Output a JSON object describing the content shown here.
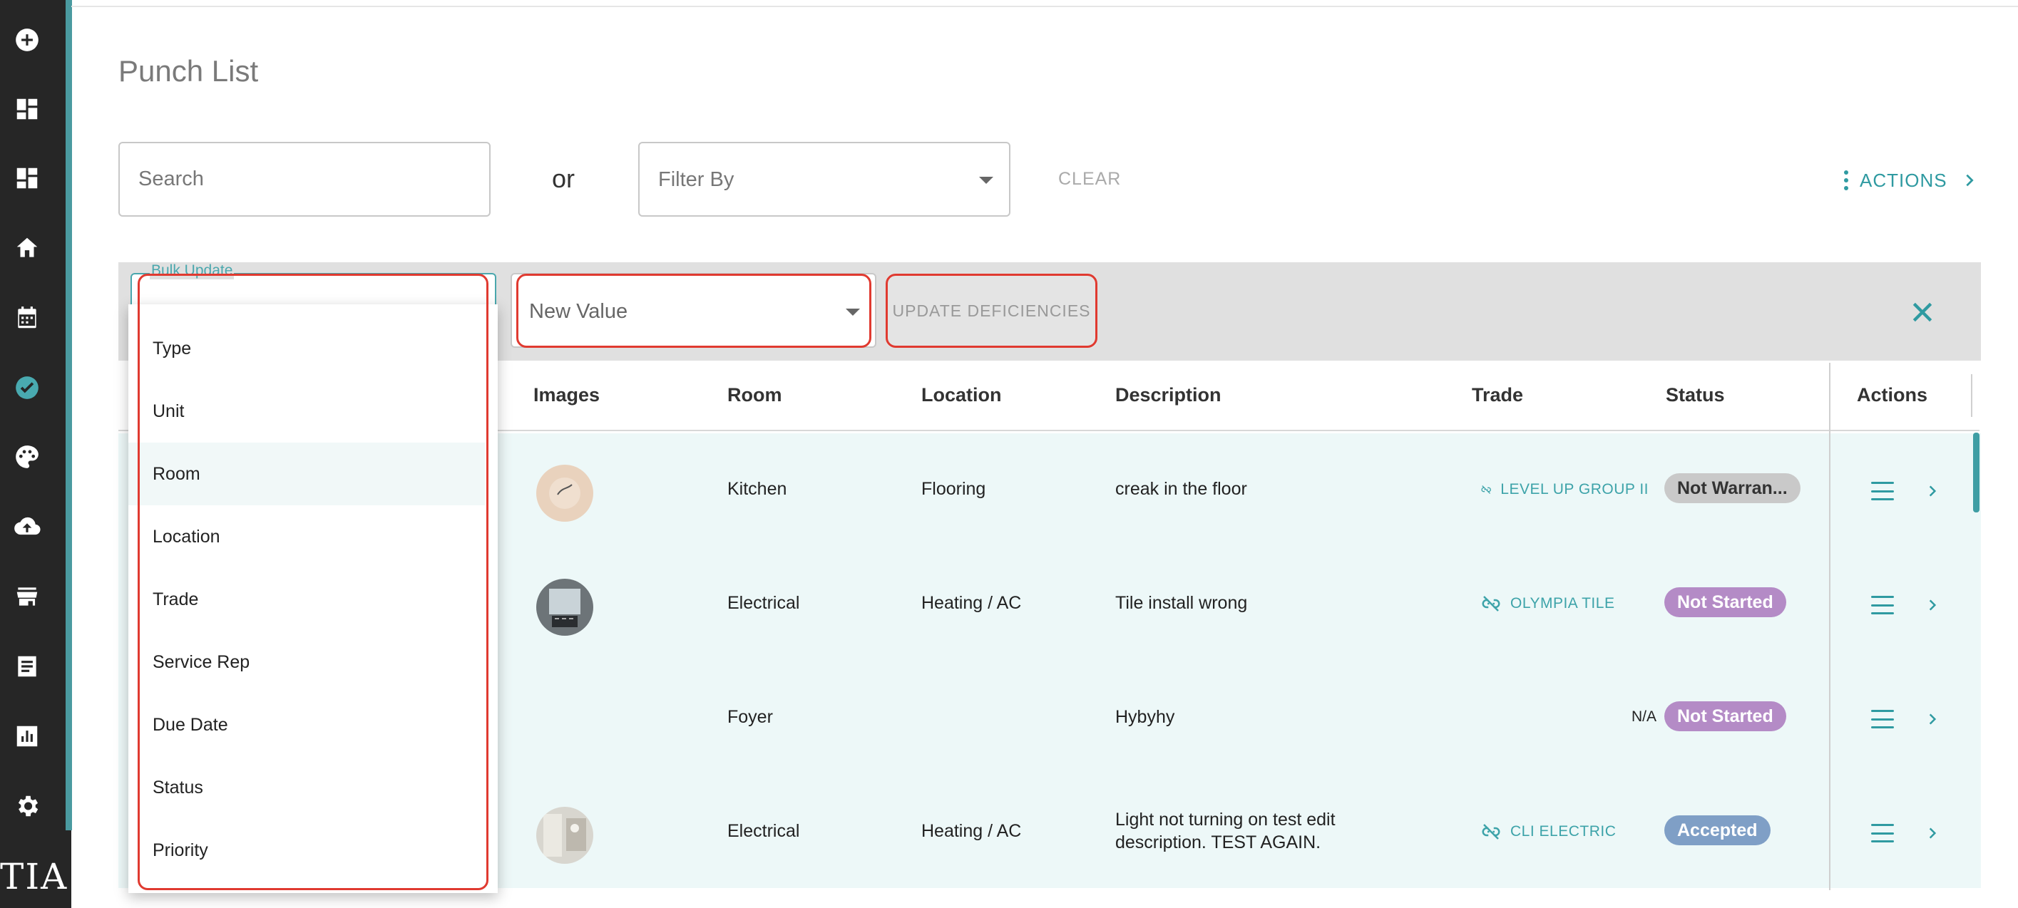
{
  "sidebar": {
    "icons": [
      "plus-circle-icon",
      "dashboard-icon",
      "dashboard-icon",
      "home-icon",
      "calendar-icon",
      "check-circle-icon",
      "palette-icon",
      "cloud-upload-icon",
      "store-icon",
      "document-icon",
      "report-icon",
      "gear-icon"
    ],
    "active": "check-circle-icon",
    "logo": "TIA"
  },
  "page": {
    "title": "Punch List"
  },
  "toolbar": {
    "search_placeholder": "Search",
    "or_label": "or",
    "filter_placeholder": "Filter By",
    "clear_label": "CLEAR",
    "actions_label": "ACTIONS"
  },
  "bulk_update": {
    "field_label": "Bulk Update",
    "new_value_placeholder": "New Value",
    "update_label": "UPDATE DEFICIENCIES",
    "field_options": [
      "Type",
      "Unit",
      "Room",
      "Location",
      "Trade",
      "Service Rep",
      "Due Date",
      "Status",
      "Priority"
    ],
    "highlighted_option": "Room"
  },
  "table": {
    "columns": [
      "Images",
      "Room",
      "Location",
      "Description",
      "Trade",
      "Status",
      "Actions"
    ],
    "rows": [
      {
        "room": "Kitchen",
        "location": "Flooring",
        "description": [
          "creak in the floor"
        ],
        "trade": "LEVEL UP GROUP II",
        "status": "Not Warran...",
        "status_color": "#c9c9c9",
        "status_text_color": "#333333",
        "has_image": true
      },
      {
        "room": "Electrical",
        "location": "Heating / AC",
        "description": [
          "Tile install wrong"
        ],
        "trade": "OLYMPIA TILE",
        "status": "Not Started",
        "status_color": "#b48bc6",
        "status_text_color": "#ffffff",
        "has_image": true
      },
      {
        "room": "Foyer",
        "location": "",
        "description": [
          "Hybyhy"
        ],
        "trade": "N/A",
        "status": "Not Started",
        "status_color": "#b48bc6",
        "status_text_color": "#ffffff",
        "has_image": false
      },
      {
        "room": "Electrical",
        "location": "Heating / AC",
        "description": [
          "Light not turning on test edit",
          "description. TEST AGAIN."
        ],
        "trade": "CLI ELECTRIC",
        "status": "Accepted",
        "status_color": "#7f9fc6",
        "status_text_color": "#ffffff",
        "has_image": true
      }
    ]
  },
  "colors": {
    "accent": "#2f9aa1",
    "sidebar": "#262626",
    "annotation": "#e03a30"
  }
}
